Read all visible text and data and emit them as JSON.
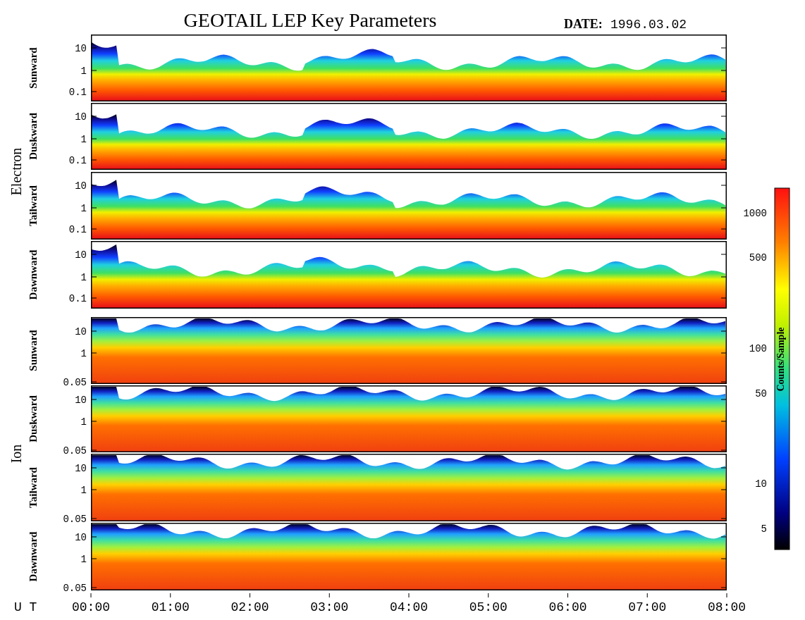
{
  "title": "GEOTAIL LEP Key Parameters",
  "date_label": "DATE:",
  "date": "1996.03.02",
  "groups": [
    {
      "name": "Electron",
      "kind": "electron",
      "panels": [
        {
          "name": "Sunward",
          "yticks": [
            "10",
            "1",
            "0.1"
          ]
        },
        {
          "name": "Duskward",
          "yticks": [
            "10",
            "1",
            "0.1"
          ]
        },
        {
          "name": "Tailward",
          "yticks": [
            "10",
            "1",
            "0.1"
          ]
        },
        {
          "name": "Dawnward",
          "yticks": [
            "10",
            "1",
            "0.1"
          ]
        }
      ]
    },
    {
      "name": "Ion",
      "kind": "ion",
      "panels": [
        {
          "name": "Sunward",
          "yticks": [
            "10",
            "1",
            "0.05"
          ]
        },
        {
          "name": "Duskward",
          "yticks": [
            "10",
            "1",
            "0.05"
          ]
        },
        {
          "name": "Tailward",
          "yticks": [
            "10",
            "1",
            "0.05"
          ]
        },
        {
          "name": "Dawnward",
          "yticks": [
            "10",
            "1",
            "0.05"
          ]
        }
      ]
    }
  ],
  "xaxis": {
    "label": "U T",
    "ticks": [
      "00:00",
      "01:00",
      "02:00",
      "03:00",
      "04:00",
      "05:00",
      "06:00",
      "07:00",
      "08:00"
    ]
  },
  "colorbar": {
    "label": "Counts/Sample",
    "ticks": [
      "1000",
      "500",
      "100",
      "50",
      "10",
      "5"
    ]
  }
}
